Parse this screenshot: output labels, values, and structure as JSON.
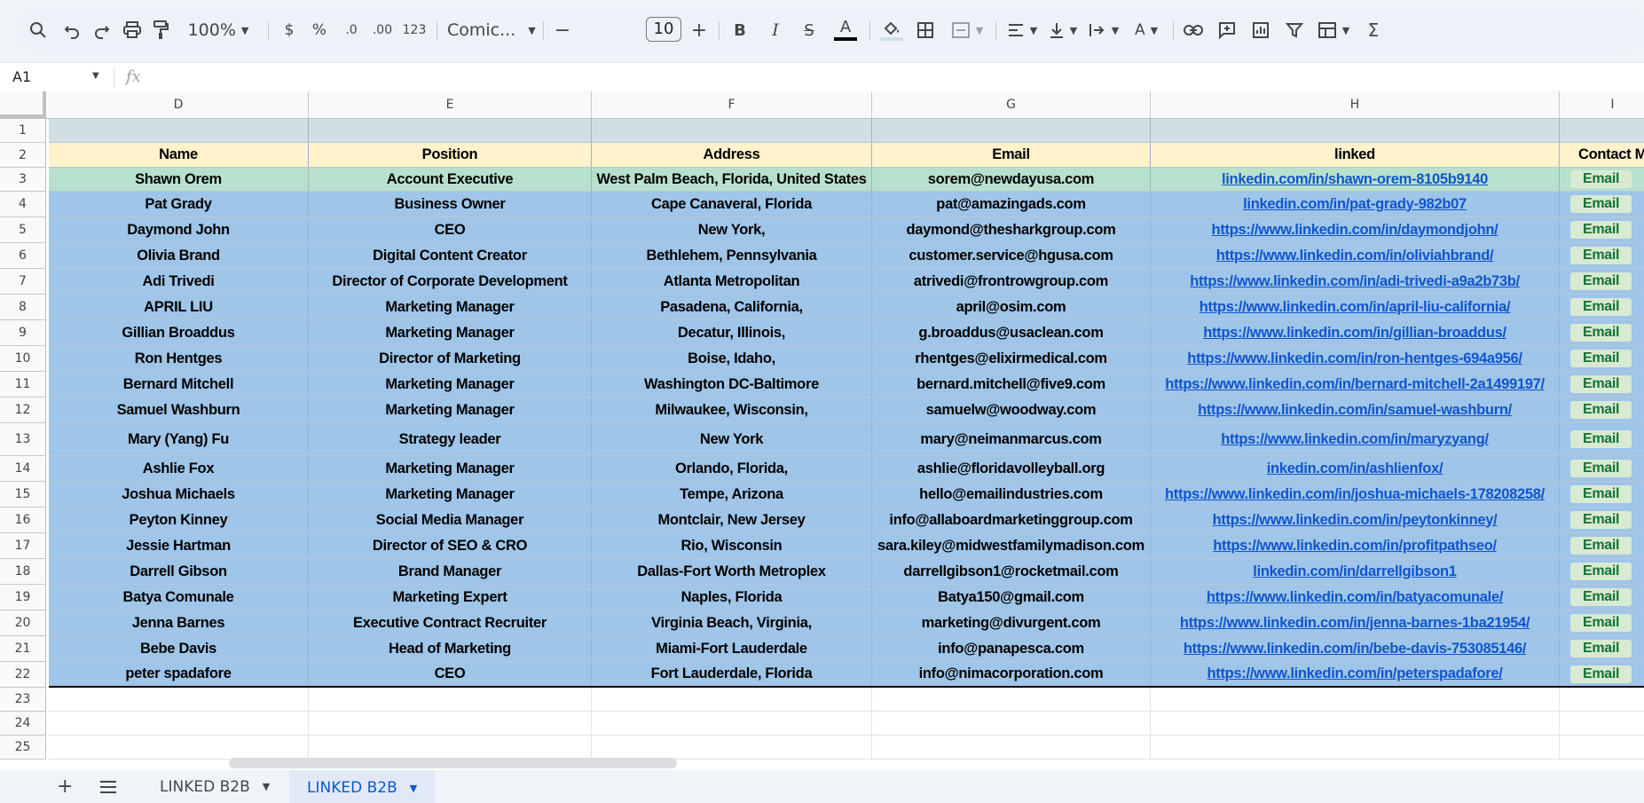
{
  "toolbar": {
    "zoom": "100%",
    "currency": "$",
    "percent": "%",
    "dec_decrease": ".0",
    "dec_increase": ".00",
    "number_format": "123",
    "font": "Comic...",
    "font_size": "10"
  },
  "formula_bar": {
    "cell_ref": "A1",
    "fx": "fx",
    "value": ""
  },
  "columns": [
    "D",
    "E",
    "F",
    "G",
    "H",
    "I"
  ],
  "header_row": [
    "Name",
    "Position",
    "Address",
    "Email",
    "linked",
    "Contact M"
  ],
  "rows": [
    [
      "Shawn Orem",
      "Account Executive",
      "West Palm Beach, Florida, United States",
      "sorem@newdayusa.com",
      "linkedin.com/in/shawn-orem-8105b9140",
      "Email"
    ],
    [
      "Pat Grady",
      "Business Owner",
      "Cape Canaveral, Florida",
      "pat@amazingads.com",
      "linkedin.com/in/pat-grady-982b07",
      "Email"
    ],
    [
      "Daymond John",
      "CEO",
      "New York,",
      "daymond@thesharkgroup.com",
      "https://www.linkedin.com/in/daymondjohn/",
      "Email"
    ],
    [
      "Olivia Brand",
      "Digital Content Creator",
      "Bethlehem, Pennsylvania",
      "customer.service@hgusa.com",
      "https://www.linkedin.com/in/oliviahbrand/",
      "Email"
    ],
    [
      "Adi Trivedi",
      "Director of Corporate Development",
      "Atlanta Metropolitan",
      "atrivedi@frontrowgroup.com",
      "https://www.linkedin.com/in/adi-trivedi-a9a2b73b/",
      "Email"
    ],
    [
      "APRIL LIU",
      "Marketing Manager",
      "Pasadena, California,",
      "april@osim.com",
      "https://www.linkedin.com/in/april-liu-california/",
      "Email"
    ],
    [
      "Gillian Broaddus",
      "Marketing Manager",
      "Decatur, Illinois,",
      "g.broaddus@usaclean.com",
      "https://www.linkedin.com/in/gillian-broaddus/",
      "Email"
    ],
    [
      "Ron Hentges",
      "Director of Marketing",
      "Boise, Idaho,",
      "rhentges@elixirmedical.com",
      "https://www.linkedin.com/in/ron-hentges-694a956/",
      "Email"
    ],
    [
      "Bernard Mitchell",
      "Marketing Manager",
      "Washington DC-Baltimore",
      "bernard.mitchell@five9.com",
      "https://www.linkedin.com/in/bernard-mitchell-2a1499197/",
      "Email"
    ],
    [
      "Samuel Washburn",
      "Marketing Manager",
      "Milwaukee, Wisconsin,",
      "samuelw@woodway.com",
      "https://www.linkedin.com/in/samuel-washburn/",
      "Email"
    ],
    [
      "Mary (Yang) Fu",
      "Strategy leader",
      "New York",
      "mary@neimanmarcus.com",
      "https://www.linkedin.com/in/maryzyang/",
      "Email"
    ],
    [
      "Ashlie Fox",
      "Marketing Manager",
      "Orlando, Florida,",
      "ashlie@floridavolleyball.org",
      "inkedin.com/in/ashlienfox/",
      "Email"
    ],
    [
      "Joshua Michaels",
      "Marketing Manager",
      "Tempe, Arizona",
      "hello@emailindustries.com",
      "https://www.linkedin.com/in/joshua-michaels-178208258/",
      "Email"
    ],
    [
      "Peyton Kinney",
      "Social Media Manager",
      "Montclair, New Jersey",
      "info@allaboardmarketinggroup.com",
      "https://www.linkedin.com/in/peytonkinney/",
      "Email"
    ],
    [
      "Jessie Hartman",
      "Director of SEO & CRO",
      "Rio, Wisconsin",
      "sara.kiley@midwestfamilymadison.com",
      "https://www.linkedin.com/in/profitpathseo/",
      "Email"
    ],
    [
      "Darrell Gibson",
      "Brand Manager",
      "Dallas-Fort Worth Metroplex",
      "darrellgibson1@rocketmail.com",
      "linkedin.com/in/darrellgibson1",
      "Email"
    ],
    [
      "Batya Comunale",
      "Marketing Expert",
      "Naples, Florida",
      "Batya150@gmail.com",
      "https://www.linkedin.com/in/batyacomunale/",
      "Email"
    ],
    [
      "Jenna Barnes",
      "Executive Contract Recruiter",
      "Virginia Beach, Virginia,",
      "marketing@divurgent.com",
      "https://www.linkedin.com/in/jenna-barnes-1ba21954/",
      "Email"
    ],
    [
      "Bebe Davis",
      "Head of Marketing",
      "Miami-Fort Lauderdale",
      "info@panapesca.com",
      "https://www.linkedin.com/in/bebe-davis-753085146/",
      "Email"
    ],
    [
      "peter spadafore",
      "CEO",
      "Fort Lauderdale, Florida",
      "info@nimacorporation.com",
      "https://www.linkedin.com/in/peterspadafore/",
      "Email"
    ]
  ],
  "row_numbers": [
    "1",
    "2",
    "3",
    "4",
    "5",
    "6",
    "7",
    "8",
    "9",
    "10",
    "11",
    "12",
    "13",
    "14",
    "15",
    "16",
    "17",
    "18",
    "19",
    "20",
    "21",
    "22",
    "23",
    "24",
    "25"
  ],
  "colors": {
    "row1": "#d0dfe3",
    "header": "#fff2cc",
    "first_data": "#b7e1cd",
    "data": "#9fc5e8",
    "link": "#1155cc",
    "email_pill": "#d9ead3"
  },
  "sheets": [
    {
      "name": "LINKED B2B",
      "active": false
    },
    {
      "name": "LINKED B2B",
      "active": true
    }
  ]
}
